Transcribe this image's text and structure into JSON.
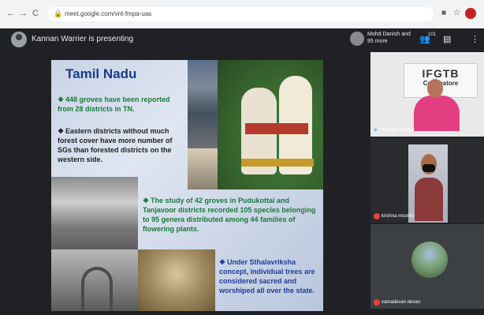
{
  "browser": {
    "url": "meet.google.com/vnt-fmpa-uas",
    "back": "←",
    "forward": "→",
    "reload": "C"
  },
  "meet": {
    "presenter_text": "Kannan Warrier is presenting",
    "participants_text": "Mohd Danish and 95 more",
    "people_count": "101"
  },
  "slide": {
    "title": "Tamil Nadu",
    "bullets": [
      "448 groves have been reported from 28 districts in TN.",
      "Eastern districts without much forest cover have more number of SGs than forested districts on the western side.",
      "The study of 42 groves in Pudukottai and Tanjavoor districts recorded 105 species belonging to 95 genera distributed among 44 families of flowering plants.",
      "Under Sthalavriksha concept, individual trees are considered sacred and worshiped all over the state."
    ],
    "bullet_marker": "❖",
    "ifgtb_title": "IFGTB",
    "ifgtb_sub": "Coimbatore"
  },
  "tiles": [
    {
      "name": "Kannan Warrier",
      "muted": false
    },
    {
      "name": "krishna moorthi",
      "muted": true
    },
    {
      "name": "vamadevan devan",
      "muted": true
    }
  ]
}
